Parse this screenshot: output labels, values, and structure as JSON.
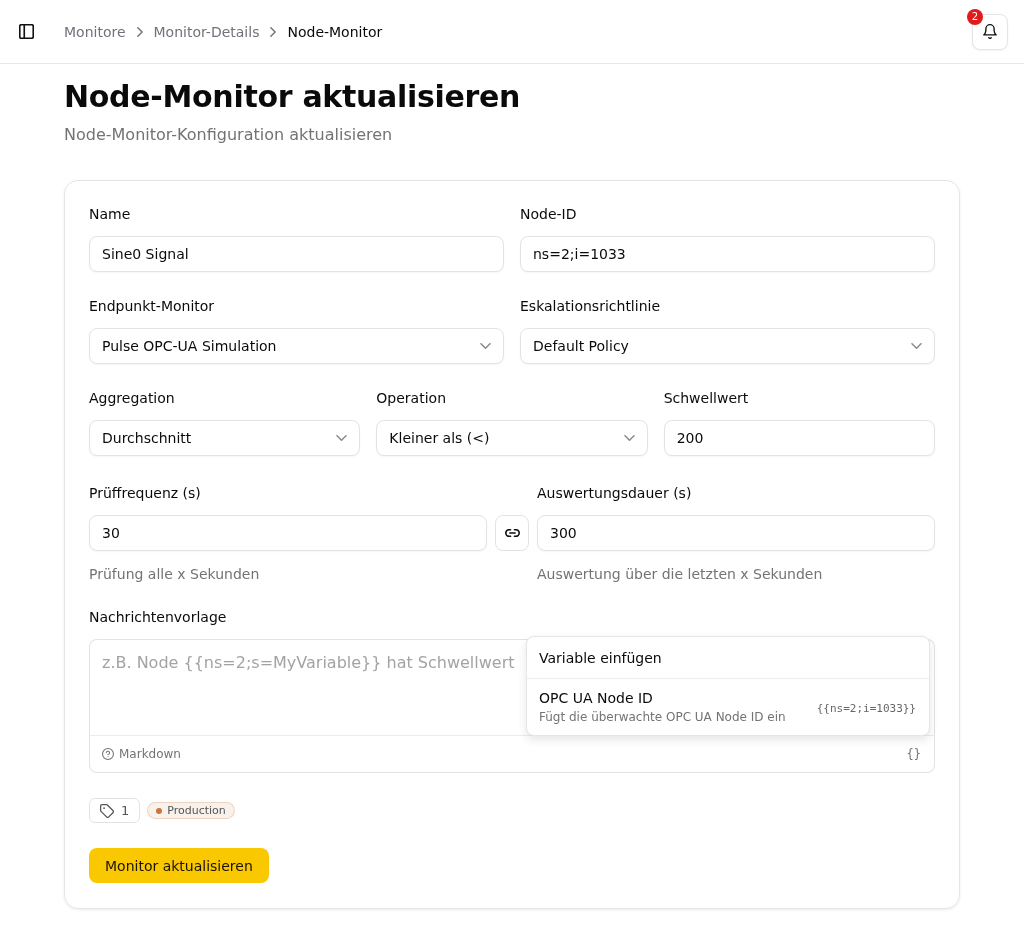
{
  "header": {
    "breadcrumbs": [
      {
        "label": "Monitore",
        "current": false
      },
      {
        "label": "Monitor-Details",
        "current": false
      },
      {
        "label": "Node-Monitor",
        "current": true
      }
    ],
    "notification_count": "2"
  },
  "page": {
    "title": "Node-Monitor aktualisieren",
    "subtitle": "Node-Monitor-Konfiguration aktualisieren"
  },
  "form": {
    "rows": [
      [
        {
          "kind": "input",
          "label": "Name",
          "value": "Sine0 Signal"
        },
        {
          "kind": "input",
          "label": "Node-ID",
          "value": "ns=2;i=1033"
        }
      ],
      [
        {
          "kind": "select",
          "label": "Endpunkt-Monitor",
          "value": "Pulse OPC-UA Simulation"
        },
        {
          "kind": "select",
          "label": "Eskalationsrichtlinie",
          "value": "Default Policy"
        }
      ],
      [
        {
          "kind": "select",
          "label": "Aggregation",
          "value": "Durchschnitt"
        },
        {
          "kind": "select",
          "label": "Operation",
          "value": "Kleiner als (<)"
        },
        {
          "kind": "input",
          "label": "Schwellwert",
          "value": "200"
        }
      ]
    ],
    "timing": [
      {
        "label": "Prüffrequenz (s)",
        "value": "30",
        "hint": "Prüfung alle x Sekunden"
      },
      {
        "label": "Auswertungsdauer (s)",
        "value": "300",
        "hint": "Auswertung über die letzten x Sekunden"
      }
    ],
    "message_template": {
      "label": "Nachrichtenvorlage",
      "placeholder": "z.B. Node {{ns=2;s=MyVariable}} hat Schwellwert",
      "footer_label": "Markdown",
      "footer_action": "{}"
    },
    "variable_menu": {
      "title": "Variable einfügen",
      "items": [
        {
          "name": "OPC UA Node ID",
          "description": "Fügt die überwachte OPC UA Node ID ein",
          "token": "{{ns=2;i=1033}}"
        }
      ]
    },
    "tags": {
      "count": "1",
      "items": [
        {
          "label": "Production",
          "color": "#c8773f"
        }
      ]
    },
    "submit": "Monitor aktualisieren"
  }
}
